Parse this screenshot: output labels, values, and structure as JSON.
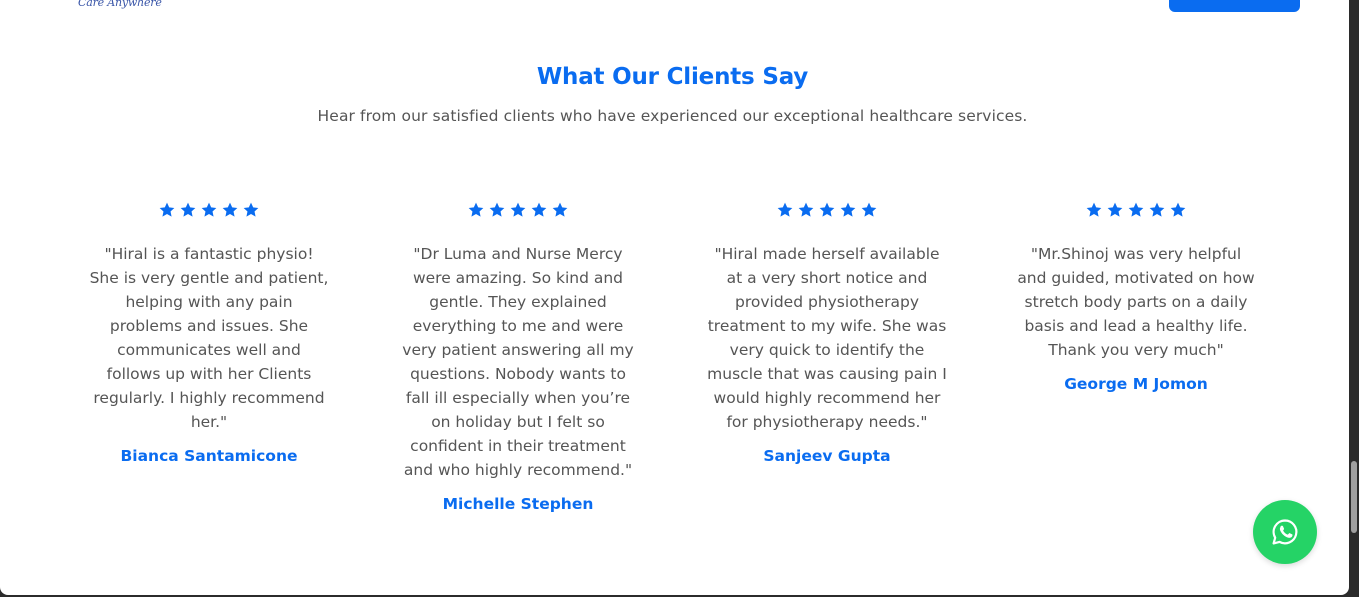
{
  "header": {
    "logo_text": "Care Anywhere"
  },
  "section": {
    "title": "What Our Clients Say",
    "subtitle": "Hear from our satisfied clients who have experienced our exceptional healthcare services."
  },
  "reviews": [
    {
      "rating": 5,
      "quote": "\"Hiral is a fantastic physio! She is very gentle and patient, helping with any pain problems and issues. She communicates well and follows up with her Clients regularly. I highly recommend her.\"",
      "author": "Bianca Santamicone"
    },
    {
      "rating": 5,
      "quote": "\"Dr Luma and Nurse Mercy were amazing. So kind and gentle. They explained everything to me and were very patient answering all my questions. Nobody wants to fall ill especially when you’re on holiday but I felt so confident in their treatment and who highly recommend.\"",
      "author": "Michelle Stephen"
    },
    {
      "rating": 5,
      "quote": "\"Hiral made herself available at a very short notice and provided physiotherapy treatment to my wife. She was very quick to identify the muscle that was causing pain I would highly recommend her for physiotherapy needs.\"",
      "author": "Sanjeev Gupta"
    },
    {
      "rating": 5,
      "quote": "\"Mr.Shinoj was very helpful and guided, motivated on how stretch body parts on a daily basis and lead a healthy life. Thank you very much\"",
      "author": "George M Jomon"
    }
  ],
  "colors": {
    "accent": "#0a6cf0",
    "body_text": "#555555",
    "whatsapp": "#25d366"
  },
  "icons": {
    "star": "star-icon",
    "whatsapp": "whatsapp-icon"
  }
}
